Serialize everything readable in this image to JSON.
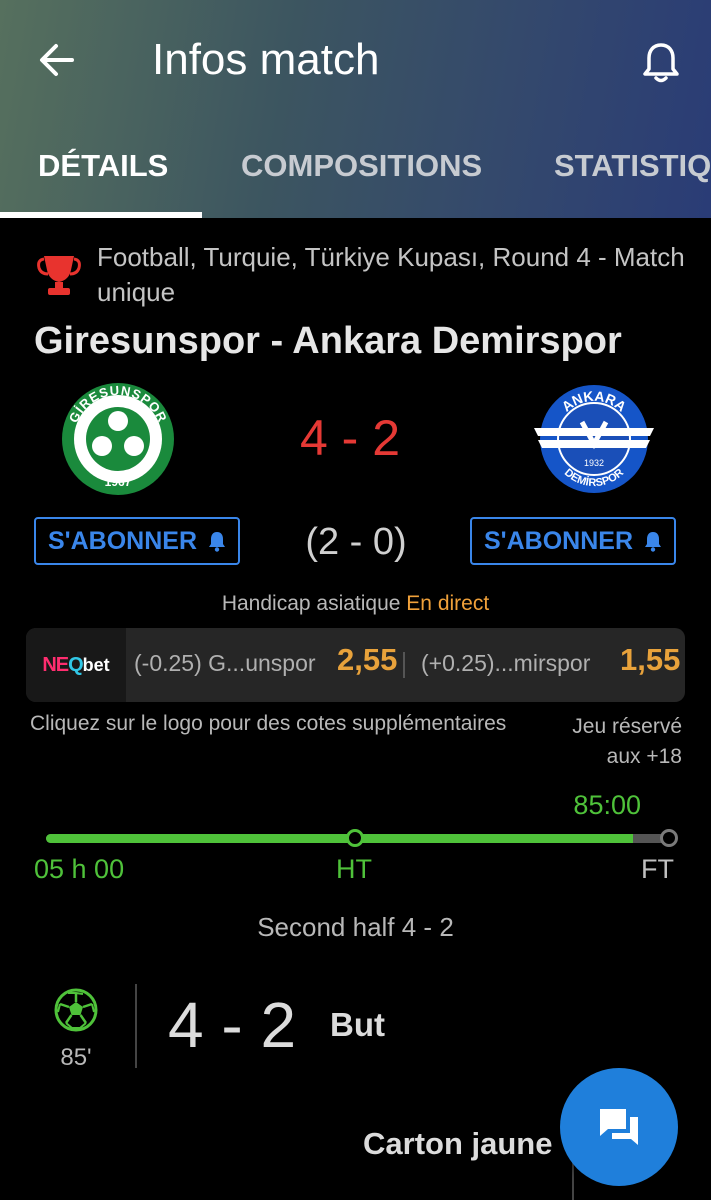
{
  "header": {
    "title": "Infos match",
    "tabs": [
      {
        "label": "DÉTAILS",
        "active": true
      },
      {
        "label": "COMPOSITIONS",
        "active": false
      },
      {
        "label": "STATISTIQ",
        "active": false
      }
    ]
  },
  "match": {
    "competition": "Football, Turquie, Türkiye Kupası, Round 4 - Match unique",
    "title": "Giresunspor - Ankara Demirspor",
    "score": "4 - 2",
    "halftime_score": "(2 - 0)"
  },
  "home_team": {
    "logo": {
      "top_text": "GİRESUNSPOR",
      "year": "1967",
      "color": "#1a8a3c"
    }
  },
  "away_team": {
    "logo": {
      "top_text": "ANKARA",
      "bottom_text": "DEMİRSPOR",
      "year": "1932",
      "color": "#1555c8"
    }
  },
  "subscribe": {
    "label": "S'ABONNER"
  },
  "odds": {
    "market_label": "Handicap asiatique",
    "live_label": "En direct",
    "bookmaker": {
      "name_a": "NE",
      "name_q": "Q",
      "name_b": "bet"
    },
    "home": {
      "label": "(-0.25) G...unspor",
      "value": "2,55"
    },
    "away": {
      "label": "(+0.25)...mirspor",
      "value": "1,55"
    },
    "note": "Cliquez sur le logo pour des cotes supplémentaires",
    "age_note": "Jeu réservé aux +18"
  },
  "timeline": {
    "current_minute": "85:00",
    "progress_fraction": 0.94,
    "start_label": "05 h 00",
    "ht_label": "HT",
    "ft_label": "FT"
  },
  "events": {
    "period_label": "Second half 4 - 2",
    "items": [
      {
        "minute": "85'",
        "score": "4 - 2",
        "type": "But",
        "icon": "football-icon"
      },
      {
        "type": "Carton jaune"
      }
    ]
  },
  "colors": {
    "accent_blue": "#3a86ea",
    "score_red": "#e53935",
    "live_green": "#4fc23a",
    "odds_orange": "#e8a23b",
    "fab_blue": "#1f7fdb"
  }
}
